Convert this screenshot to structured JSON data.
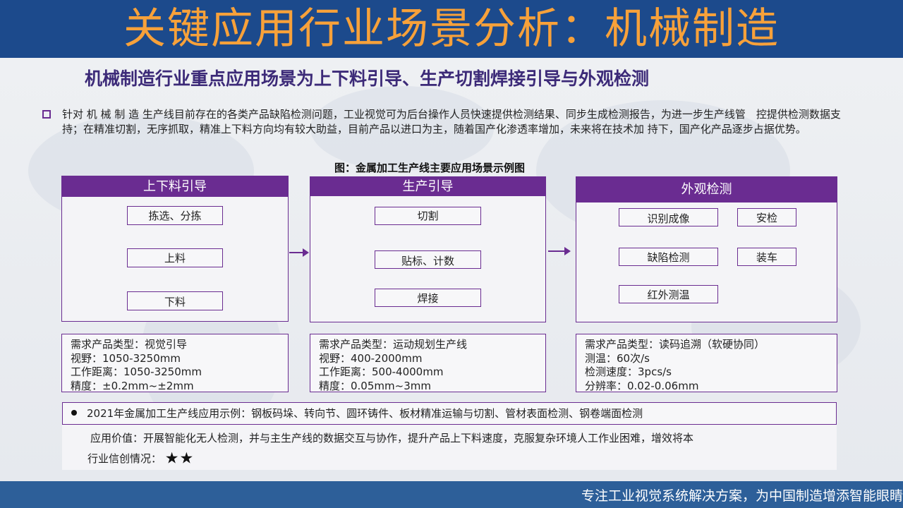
{
  "header": {
    "title": "关键应用行业场景分析：机械制造"
  },
  "subtitle": "机械制造行业重点应用场景为上下料引导、生产切割焊接引导与外观检测",
  "intro": "针对 机 械 制 造 生产线目前存在的各类产品缺陷检测问题，工业视觉可为后台操作人员快速提供检测结果、同步生成检测报告，为进一步生产线管　控提供检测数据支持；在精准切割，无序抓取，精准上下料方向均有较大助益，目前产品以进口为主，随着国产化渗透率增加，未来将在技术加 持下，国产化产品逐步占据优势。",
  "figure_caption": "图：金属加工生产线主要应用场景示例图",
  "panels": [
    {
      "title": "上下料引导",
      "items": [
        "拣选、分拣",
        "上料",
        "下料"
      ]
    },
    {
      "title": "生产引导",
      "items": [
        "切割",
        "贴标、计数",
        "焊接"
      ]
    },
    {
      "title": "外观检测",
      "items": [
        "识别成像",
        "安检",
        "缺陷检测",
        "装车",
        "红外测温"
      ]
    }
  ],
  "specs": [
    [
      "需求产品类型：视觉引导",
      "视野：1050-3250mm",
      "工作距离：1050-3250mm",
      "精度：±0.2mm~±2mm"
    ],
    [
      "需求产品类型：运动规划生产线",
      "视野：400-2000mm",
      "工作距离：500-4000mm",
      "精度：0.05mm~3mm"
    ],
    [
      "需求产品类型：读码追溯（软硬协同）",
      "测温：60次/s",
      "检测速度：3pcs/s",
      "分辨率：0.02-0.06mm"
    ]
  ],
  "examples": "2021年金属加工生产线应用示例：钢板码垛、转向节、圆环铸件、板材精准运输与切割、管材表面检测、钢卷端面检测",
  "value": "应用价值：开展智能化无人检测，并与主生产线的数据交互与协作，提升产品上下料速度，克服复杂环境人工作业困难，增效将本",
  "rating": {
    "label": "行业信创情况：",
    "stars": "★★",
    "value": 2,
    "max": 5
  },
  "footer": "专注工业视觉系统解决方案，为中国制造增添智能眼睛",
  "colors": {
    "header_bg": "#1c4a8c",
    "title": "#f7a13a",
    "accent": "#6a2c91",
    "subtitle": "#3c2a78",
    "footer_bg": "#2d5f99"
  }
}
